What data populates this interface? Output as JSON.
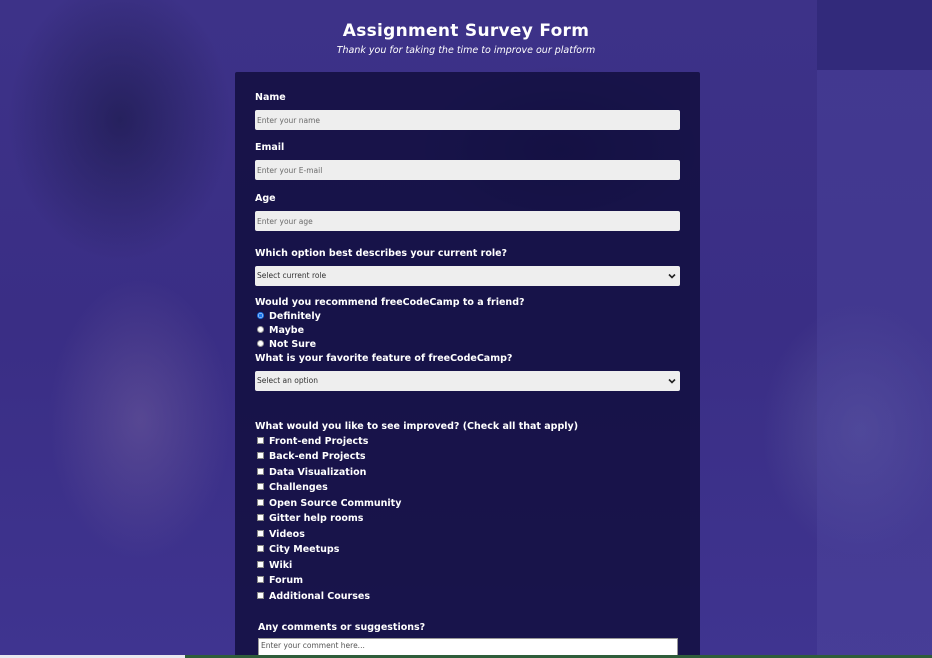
{
  "header": {
    "title": "Assignment Survey Form",
    "subtitle": "Thank you for taking the time to improve our platform"
  },
  "form": {
    "name": {
      "label": "Name",
      "placeholder": "Enter your name",
      "value": ""
    },
    "email": {
      "label": "Email",
      "placeholder": "Enter your E-mail",
      "value": ""
    },
    "age": {
      "label": "Age",
      "placeholder": "Enter your age",
      "value": ""
    },
    "role": {
      "label": "Which option best describes your current role?",
      "selected": "Select current role"
    },
    "recommend": {
      "label": "Would you recommend freeCodeCamp to a friend?",
      "options": [
        "Definitely",
        "Maybe",
        "Not Sure"
      ],
      "selected": "Definitely"
    },
    "feature": {
      "label": "What is your favorite feature of freeCodeCamp?",
      "selected": "Select an option"
    },
    "improve": {
      "label": "What would you like to see improved? (Check all that apply)",
      "options": [
        "Front-end Projects",
        "Back-end Projects",
        "Data Visualization",
        "Challenges",
        "Open Source Community",
        "Gitter help rooms",
        "Videos",
        "City Meetups",
        "Wiki",
        "Forum",
        "Additional Courses"
      ]
    },
    "comments": {
      "label": "Any comments or suggestions?",
      "placeholder": "Enter your comment here..."
    }
  },
  "icons": {
    "select_arrow": "chevron-down-icon"
  },
  "colors": {
    "background": "#3a2f86",
    "form_panel": "#100e3c",
    "input_bg": "#eeeeee",
    "radio_accent": "#1a73e8"
  }
}
